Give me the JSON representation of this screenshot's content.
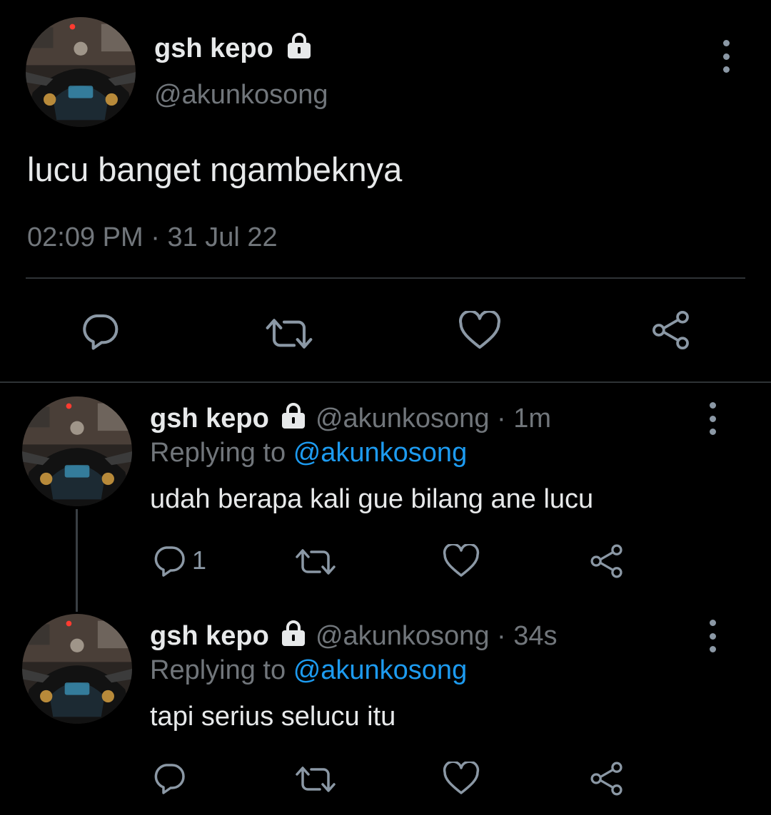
{
  "main_tweet": {
    "display_name": "gsh kepo",
    "handle": "@akunkosong",
    "text": "lucu banget ngambeknya",
    "time": "02:09 PM",
    "separator": "·",
    "date": "31 Jul 22"
  },
  "replies": [
    {
      "display_name": "gsh kepo",
      "handle": "@akunkosong",
      "separator": "·",
      "age": "1m",
      "replying_prefix": "Replying to",
      "replying_to": "@akunkosong",
      "text": "udah berapa kali gue bilang ane lucu",
      "reply_count": "1"
    },
    {
      "display_name": "gsh kepo",
      "handle": "@akunkosong",
      "separator": "·",
      "age": "34s",
      "replying_prefix": "Replying to",
      "replying_to": "@akunkosong",
      "text": "tapi serius selucu itu",
      "reply_count": ""
    }
  ],
  "icons": {
    "lock": "lock-icon",
    "more": "more-vertical-icon",
    "reply": "reply-bubble-icon",
    "retweet": "retweet-icon",
    "like": "heart-icon",
    "share": "share-icon"
  },
  "colors": {
    "background": "#000000",
    "text": "#e7e9ea",
    "muted": "#71767b",
    "link": "#1d9bf0",
    "icon": "#8b98a5"
  }
}
